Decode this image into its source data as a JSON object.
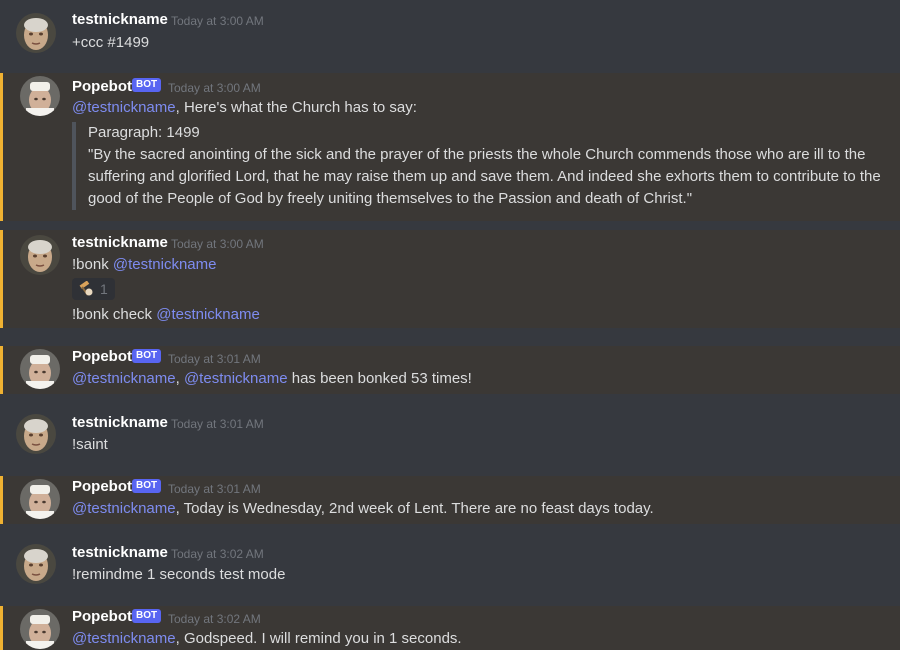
{
  "colors": {
    "background": "#36393f",
    "highlight_bg": "#3b3835",
    "highlight_border": "#f0b232",
    "mention": "#7e8cf0",
    "bot_tag": "#5865f2",
    "timestamp": "#72767d"
  },
  "messages": [
    {
      "author": "testnickname",
      "timestamp": "Today at 3:00 AM",
      "lines": [
        "+ccc #1499"
      ]
    },
    {
      "author": "Popebot",
      "bot_tag": "BOT",
      "timestamp": "Today at 3:00 AM",
      "mention": "@testnickname",
      "text": ", Here's what the Church has to say:",
      "quote": {
        "line1": "Paragraph: 1499",
        "line2": " \"By the sacred anointing of the sick and the prayer of the priests the whole Church commends those who are ill to the",
        "line3": "suffering and glorified Lord, that he may raise them up and save them. And indeed she exhorts them to contribute to the",
        "line4": "good of the People of God by freely uniting themselves to the Passion and death of Christ.\""
      }
    },
    {
      "author": "testnickname",
      "timestamp": "Today at 3:00 AM",
      "line1_text": "!bonk ",
      "line1_mention": "@testnickname",
      "reaction_icon": "bonk-emoji-icon",
      "reaction_count": "1",
      "line2_text": "!bonk check ",
      "line2_mention": "@testnickname"
    },
    {
      "author": "Popebot",
      "bot_tag": "BOT",
      "timestamp": "Today at 3:01 AM",
      "mention1": "@testnickname",
      "sep": ", ",
      "mention2": "@testnickname",
      "text": " has been bonked 53 times!"
    },
    {
      "author": "testnickname",
      "timestamp": "Today at 3:01 AM",
      "text": "!saint"
    },
    {
      "author": "Popebot",
      "bot_tag": "BOT",
      "timestamp": "Today at 3:01 AM",
      "mention": "@testnickname",
      "text": ", Today is Wednesday, 2nd week of Lent. There are no feast days today."
    },
    {
      "author": "testnickname",
      "timestamp": "Today at 3:02 AM",
      "text": "!remindme 1 seconds test mode"
    },
    {
      "author": "Popebot",
      "bot_tag": "BOT",
      "timestamp": "Today at 3:02 AM",
      "mention": "@testnickname",
      "text": ", Godspeed. I will remind you in 1 seconds."
    }
  ]
}
